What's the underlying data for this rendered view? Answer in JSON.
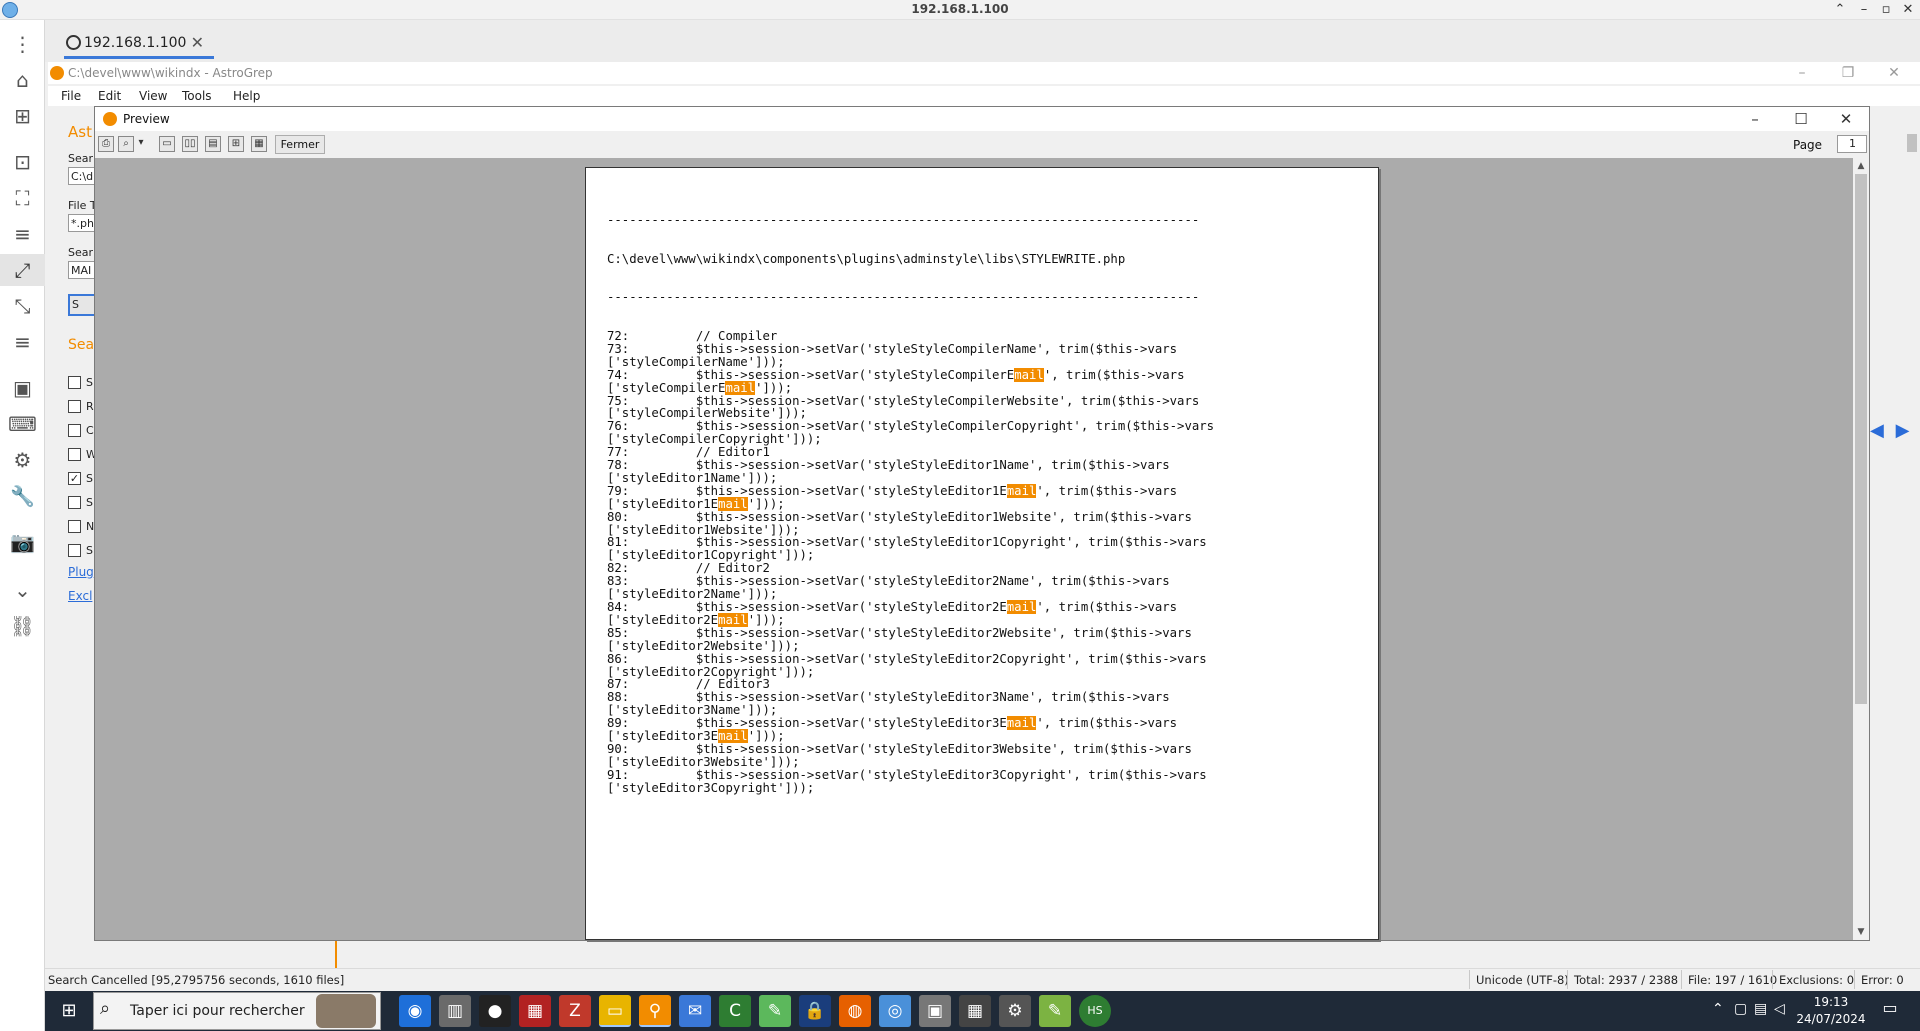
{
  "remote": {
    "title": "192.168.1.100",
    "tab_label": "192.168.1.100",
    "tab_close": "✕"
  },
  "astrogrep": {
    "title": "C:\\devel\\www\\wikindx - AstroGrep",
    "menu": [
      "File",
      "Edit",
      "View",
      "Tools",
      "Help"
    ],
    "left_fragments": {
      "ast": "Ast",
      "search_path_label": "Sear",
      "search_path_value": "C:\\d",
      "file_types_label": "File T",
      "file_types_value": "*.ph",
      "search_text_label": "Sear",
      "search_text_value": "MAI",
      "search_btn": "S",
      "options_header": "Sea",
      "checkboxes": [
        {
          "label": "S",
          "checked": false
        },
        {
          "label": "R",
          "checked": false
        },
        {
          "label": "C",
          "checked": false
        },
        {
          "label": "W",
          "checked": false
        },
        {
          "label": "S",
          "checked": true
        },
        {
          "label": "S",
          "checked": false
        },
        {
          "label": "N",
          "checked": false
        },
        {
          "label": "S",
          "checked": false
        }
      ],
      "plugins_link": "Plug",
      "exclusions_link": "Excl"
    }
  },
  "preview": {
    "title": "Preview",
    "close_button": "Fermer",
    "page_label": "Page",
    "page_value": "1",
    "file_path": "C:\\devel\\www\\wikindx\\components\\plugins\\adminstyle\\libs\\STYLEWRITE.php",
    "separator": "--------------------------------------------------------------------------------",
    "highlight_term": "mail"
  },
  "code_lines": [
    "72:         // Compiler",
    "73:         $this->session->setVar('styleStyleCompilerName', trim($this->vars",
    "['styleCompilerName']));",
    "74:         $this->session->setVar('styleStyleCompilerE[[mail]]', trim($this->vars",
    "['styleCompilerE[[mail]]']));",
    "75:         $this->session->setVar('styleStyleCompilerWebsite', trim($this->vars",
    "['styleCompilerWebsite']));",
    "76:         $this->session->setVar('styleStyleCompilerCopyright', trim($this->vars",
    "['styleCompilerCopyright']));",
    "77:         // Editor1",
    "78:         $this->session->setVar('styleStyleEditor1Name', trim($this->vars",
    "['styleEditor1Name']));",
    "79:         $this->session->setVar('styleStyleEditor1E[[mail]]', trim($this->vars",
    "['styleEditor1E[[mail]]']));",
    "80:         $this->session->setVar('styleStyleEditor1Website', trim($this->vars",
    "['styleEditor1Website']));",
    "81:         $this->session->setVar('styleStyleEditor1Copyright', trim($this->vars",
    "['styleEditor1Copyright']));",
    "82:         // Editor2",
    "83:         $this->session->setVar('styleStyleEditor2Name', trim($this->vars",
    "['styleEditor2Name']));",
    "84:         $this->session->setVar('styleStyleEditor2E[[mail]]', trim($this->vars",
    "['styleEditor2E[[mail]]']));",
    "85:         $this->session->setVar('styleStyleEditor2Website', trim($this->vars",
    "['styleEditor2Website']));",
    "86:         $this->session->setVar('styleStyleEditor2Copyright', trim($this->vars",
    "['styleEditor2Copyright']));",
    "87:         // Editor3",
    "88:         $this->session->setVar('styleStyleEditor3Name', trim($this->vars",
    "['styleEditor3Name']));",
    "89:         $this->session->setVar('styleStyleEditor3E[[mail]]', trim($this->vars",
    "['styleEditor3E[[mail]]']));",
    "90:         $this->session->setVar('styleStyleEditor3Website', trim($this->vars",
    "['styleEditor3Website']));",
    "91:         $this->session->setVar('styleStyleEditor3Copyright', trim($this->vars",
    "['styleEditor3Copyright']));"
  ],
  "status": {
    "left": "Search Cancelled [95,2795756 seconds, 1610 files]",
    "encoding": "Unicode (UTF-8)",
    "total": "Total: 2937 / 2388",
    "file": "File: 197 / 1610",
    "exclusions": "Exclusions: 0",
    "error": "Error: 0"
  },
  "taskbar": {
    "search_placeholder": "Taper ici pour rechercher",
    "time": "19:13",
    "date": "24/07/2024",
    "apps": [
      "cortana-icon",
      "tablet-icon",
      "obs-icon",
      "winrar-icon",
      "filezilla-icon",
      "file-explorer-icon",
      "astrogrep-icon",
      "outlook-icon",
      "cygwin-icon",
      "notepad-icon",
      "keepass-icon",
      "firefox-icon",
      "chrome-icon",
      "remote-desktop-icon",
      "calculator-icon",
      "settings-icon",
      "notepadpp-icon",
      "hs-icon"
    ]
  },
  "colors": {
    "accent": "#f28c00",
    "taskbar": "#1f2a38",
    "link": "#2b6cd8"
  }
}
